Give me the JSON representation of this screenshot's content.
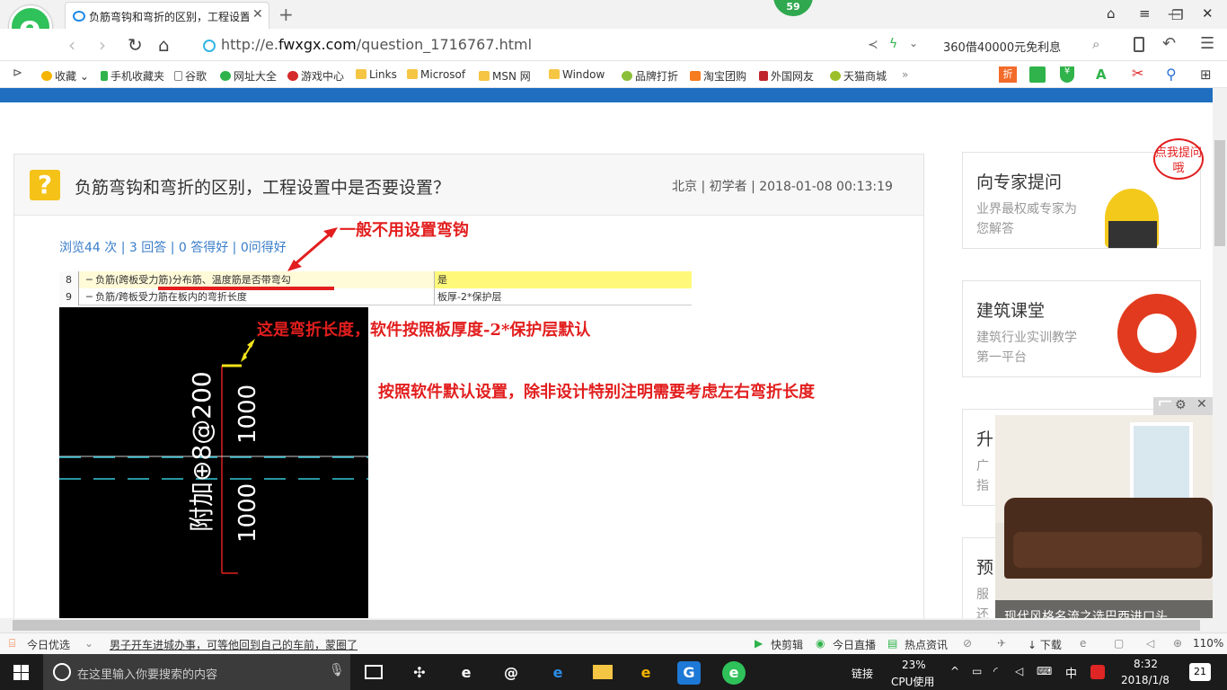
{
  "browser": {
    "tab_title": "负筋弯钩和弯折的区别，工程设置中是否要设置？",
    "badge": "59",
    "url_prefix": "http://e.",
    "url_domain": "fwxgx.com",
    "url_path": "/question_1716767.html",
    "promo_text": "360借40000元免利息"
  },
  "bookmarks": [
    {
      "label": "收藏",
      "icon": "star-icon"
    },
    {
      "label": "手机收藏夹",
      "icon": "phone-icon"
    },
    {
      "label": "谷歌",
      "icon": "page-icon"
    },
    {
      "label": "网址大全",
      "icon": "globe-icon"
    },
    {
      "label": "游戏中心",
      "icon": "game-icon"
    },
    {
      "label": "Links",
      "icon": "folder-icon"
    },
    {
      "label": "Microsof",
      "icon": "folder-icon"
    },
    {
      "label": "MSN 网",
      "icon": "folder-icon"
    },
    {
      "label": "Window",
      "icon": "folder-icon"
    },
    {
      "label": "品牌打折",
      "icon": "leaf-icon"
    },
    {
      "label": "淘宝团购",
      "icon": "taobao-icon"
    },
    {
      "label": "外国网友",
      "icon": "flag-icon"
    },
    {
      "label": "天猫商城",
      "icon": "leaf-icon"
    }
  ],
  "question": {
    "title": "负筋弯钩和弯折的区别，工程设置中是否要设置？",
    "meta": "北京 | 初学者 | 2018-01-08 00:13:19",
    "stats": {
      "views": "浏览44 次",
      "answers": "3 回答",
      "good": "0 答得好",
      "asks": "0问得好"
    }
  },
  "sheet": {
    "rows": [
      {
        "num": "8",
        "name": "负筋(跨板受力筋)分布筋、温度筋是否带弯勾",
        "value": "是"
      },
      {
        "num": "9",
        "name": "负筋/跨板受力筋在板内的弯折长度",
        "value": "板厚-2*保护层"
      }
    ]
  },
  "annotations": {
    "a1": "一般不用设置弯钩",
    "a2": "这是弯折长度，软件按照板厚度-2*保护层默认",
    "a3": "按照软件默认设置，除非设计特别注明需要考虑左右弯折长度"
  },
  "cad": {
    "label_main": "附加⊕8@200",
    "dim_top": "1000",
    "dim_bottom": "1000"
  },
  "sidebar": {
    "ask_title": "向专家提问",
    "ask_desc": "业界最权威专家为您解答",
    "ask_bubble": "点我提问哦",
    "class_title": "建筑课堂",
    "class_desc": "建筑行业实训教学第一平台",
    "box3_title": "升",
    "box3_desc": "广\n指",
    "box4_title": "预",
    "box4_desc": "服\n还"
  },
  "ad": {
    "caption": "现代风格名流之选巴西进口头"
  },
  "statusbar": {
    "today": "今日优选",
    "news": "男子开车进城办事，可等他回到自己的车前，蒙圈了",
    "clip": "快剪辑",
    "live": "今日直播",
    "hot": "热点资讯",
    "download": "下载",
    "zoom": "110%"
  },
  "taskbar": {
    "search_placeholder": "在这里输入你要搜索的内容",
    "link": "链接",
    "cpu_pct": "23%",
    "cpu_label": "CPU使用",
    "ime": "中",
    "time": "8:32",
    "date": "2018/1/8",
    "notif": "21"
  },
  "colors": {
    "accent_blue": "#1f6ec0",
    "annotation_red": "#e21e1e",
    "brand_green": "#2fc15a"
  }
}
